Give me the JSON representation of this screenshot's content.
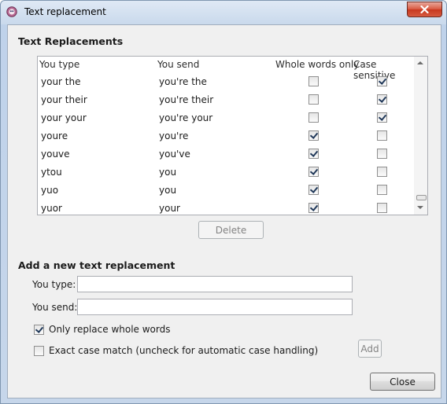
{
  "window": {
    "title": "Text replacement",
    "close_glyph": "✕"
  },
  "replacements": {
    "section_title": "Text Replacements",
    "columns": [
      "You type",
      "You send",
      "Whole words only",
      "Case sensitive"
    ],
    "rows": [
      {
        "type": "your the",
        "send": "you're the",
        "whole_words": false,
        "case_sensitive": true
      },
      {
        "type": "your their",
        "send": "you're their",
        "whole_words": false,
        "case_sensitive": true
      },
      {
        "type": "your your",
        "send": "you're your",
        "whole_words": false,
        "case_sensitive": true
      },
      {
        "type": "youre",
        "send": "you're",
        "whole_words": true,
        "case_sensitive": false
      },
      {
        "type": "youve",
        "send": "you've",
        "whole_words": true,
        "case_sensitive": false
      },
      {
        "type": "ytou",
        "send": "you",
        "whole_words": true,
        "case_sensitive": false
      },
      {
        "type": "yuo",
        "send": "you",
        "whole_words": true,
        "case_sensitive": false
      },
      {
        "type": "yuor",
        "send": "your",
        "whole_words": true,
        "case_sensitive": false
      }
    ],
    "delete_label": "Delete"
  },
  "add_new": {
    "section_title": "Add a new text replacement",
    "you_type_label": "You type:",
    "you_type_value": "",
    "you_send_label": "You send:",
    "you_send_value": "",
    "whole_words_label": "Only replace whole words",
    "whole_words_checked": true,
    "exact_case_label": "Exact case match (uncheck for automatic case handling)",
    "exact_case_checked": false,
    "add_label": "Add"
  },
  "footer": {
    "close_label": "Close"
  },
  "colors": {
    "titlebar": "#c6d6ea",
    "close_button": "#d04a32",
    "dialog_bg": "#f0f0f0"
  }
}
